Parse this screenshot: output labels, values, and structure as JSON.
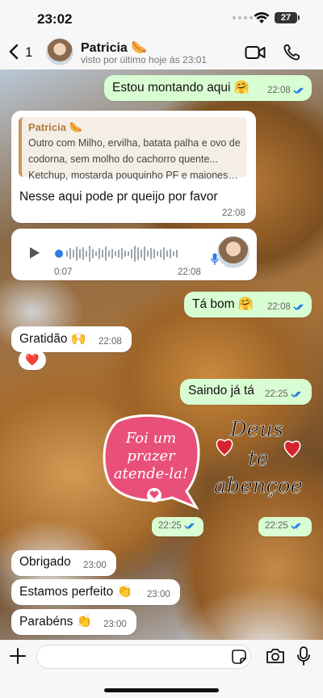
{
  "status_bar": {
    "time": "23:02",
    "battery": "27"
  },
  "header": {
    "back_count": "1",
    "contact_name": "Patricia 🌭",
    "contact_status": "visto por último hoje às 23:01"
  },
  "messages": [
    {
      "text": "Estou montando aqui 🤗",
      "time": "22:08"
    },
    {
      "quote_name": "Patricia 🌭",
      "quote_lines": [
        "Outro com  Milho, ervilha, batata palha e ovo de",
        "codorna, sem molho do cachorro quente...",
        "Ketchup, mostarda pouquinho PF e maionese e..."
      ],
      "text": "Nesse aqui pode pr queijo por favor",
      "time": "22:08"
    },
    {
      "duration": "0:07",
      "time": "22:08"
    },
    {
      "text": "Tá bom 🤗",
      "time": "22:08"
    },
    {
      "text": "Gratidão 🙌",
      "time": "22:08",
      "reaction": "❤️"
    },
    {
      "text": "Saindo já tá",
      "time": "22:25"
    },
    {
      "sticker_text": "Foi um prazer atende-la!",
      "time": "22:25"
    },
    {
      "sticker_text": "Deus te abençoe",
      "time": "22:25"
    },
    {
      "text": "Obrigado",
      "time": "23:00"
    },
    {
      "text": "Estamos perfeito 👏",
      "time": "23:00"
    },
    {
      "text": "Parabéns 👏",
      "time": "23:00"
    }
  ],
  "icons": {
    "back": "chevron-left-icon",
    "video": "video-call-icon",
    "phone": "phone-icon",
    "play": "play-icon",
    "plus": "plus-icon",
    "sticker": "sticker-icon",
    "camera": "camera-icon",
    "mic": "microphone-icon"
  },
  "colors": {
    "outgoing_bubble": "#d9fdd3",
    "incoming_bubble": "#ffffff",
    "read_ticks": "#2a7be4",
    "sticker_pink": "#e8507a"
  }
}
